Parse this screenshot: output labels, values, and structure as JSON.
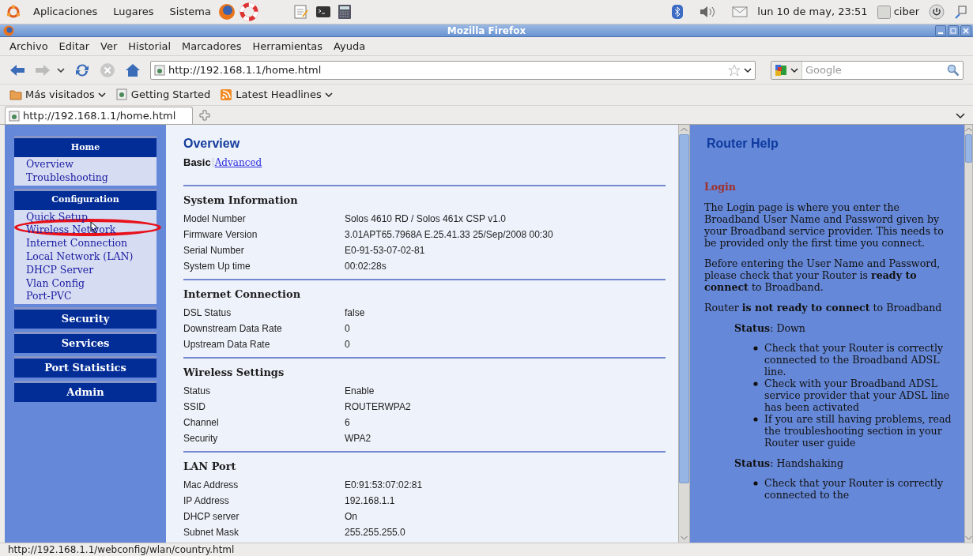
{
  "top_panel": {
    "menus": [
      "Aplicaciones",
      "Lugares",
      "Sistema"
    ],
    "clock": "lun 10 de may, 23:51",
    "user": "ciber"
  },
  "window": {
    "title": "Mozilla Firefox"
  },
  "menu_bar": [
    "Archivo",
    "Editar",
    "Ver",
    "Historial",
    "Marcadores",
    "Herramientas",
    "Ayuda"
  ],
  "navigation": {
    "url": "http://192.168.1.1/home.html",
    "search_placeholder": "Google"
  },
  "bookmarks": [
    {
      "label": "Más visitados",
      "kind": "folder"
    },
    {
      "label": "Getting Started",
      "kind": "page"
    },
    {
      "label": "Latest Headlines",
      "kind": "feed"
    }
  ],
  "tabs": [
    {
      "label": "http://192.168.1.1/home.html",
      "selected": true
    }
  ],
  "sidebar": [
    {
      "label": "Home",
      "items": [
        "Overview",
        "Troubleshooting"
      ]
    },
    {
      "label": "Configuration",
      "items": [
        "Quick Setup",
        "Wireless Network",
        "Internet Connection",
        "Local Network (LAN)",
        "DHCP Server",
        "Vlan Config",
        "Port-PVC"
      ]
    },
    {
      "label": "Security"
    },
    {
      "label": "Services"
    },
    {
      "label": "Port Statistics"
    },
    {
      "label": "Admin"
    }
  ],
  "overview": {
    "title": "Overview",
    "views": [
      {
        "label": "Basic",
        "selected": true
      },
      {
        "label": "Advanced",
        "selected": false
      }
    ],
    "sections": [
      {
        "title": "System Information",
        "rows": [
          [
            "Model Number",
            "Solos 4610 RD / Solos 461x CSP v1.0"
          ],
          [
            "Firmware Version",
            "3.01APT65.7968A E.25.41.33 25/Sep/2008 00:30"
          ],
          [
            "Serial Number",
            "E0-91-53-07-02-81"
          ],
          [
            "System Up time",
            "00:02:28s"
          ]
        ]
      },
      {
        "title": "Internet Connection",
        "rows": [
          [
            "DSL Status",
            "false"
          ],
          [
            "Downstream Data Rate",
            "0"
          ],
          [
            "Upstream Data Rate",
            "0"
          ]
        ]
      },
      {
        "title": "Wireless Settings",
        "rows": [
          [
            "Status",
            "Enable"
          ],
          [
            "SSID",
            "ROUTERWPA2"
          ],
          [
            "Channel",
            "6"
          ],
          [
            "Security",
            "WPA2"
          ]
        ]
      },
      {
        "title": "LAN Port",
        "rows": [
          [
            "Mac Address",
            "E0:91:53:07:02:81"
          ],
          [
            "IP Address",
            "192.168.1.1"
          ],
          [
            "DHCP server",
            "On"
          ],
          [
            "Subnet Mask",
            "255.255.255.0"
          ]
        ]
      }
    ]
  },
  "help": {
    "title": "Router Help",
    "heading": "Login",
    "paragraphs": [
      "The Login page is where you enter the Broadband User Name and Password given by your Broadband service provider. This needs to be provided only the first time you connect.",
      "Before entering the User Name and Password, please check that your Router is **ready to connect** to Broadband.",
      "Router **is not ready to connect** to Broadband"
    ],
    "statuses": [
      {
        "label": "**Status**: Down",
        "bullets": [
          "Check that your Router is correctly connected to the Broadband ADSL line.",
          "Check with your Broadband ADSL service provider that your ADSL line has been activated",
          "If you are still having problems, read the troubleshooting section in your Router user guide"
        ]
      },
      {
        "label": "**Status**: Handshaking",
        "bullets": [
          "Check that your Router is correctly connected to the"
        ]
      }
    ]
  },
  "status_bar": "http://192.168.1.1/webconfig/wlan/country.html"
}
